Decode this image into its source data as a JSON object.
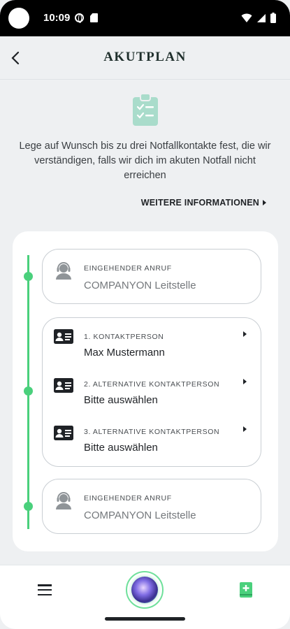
{
  "status_bar": {
    "time": "10:09"
  },
  "header": {
    "title": "AKUTPLAN"
  },
  "intro_text": "Lege auf Wunsch bis zu drei Notfallkontakte fest, die wir verständigen, falls wir dich im akuten Notfall nicht erreichen",
  "more_info_label": "WEITERE INFORMATIONEN",
  "incoming_call_top": {
    "label": "EINGEHENDER ANRUF",
    "value": "COMPANYON Leitstelle"
  },
  "contacts": [
    {
      "label": "1. KONTAKTPERSON",
      "value": "Max Mustermann"
    },
    {
      "label": "2. ALTERNATIVE KONTAKTPERSON",
      "value": "Bitte auswählen"
    },
    {
      "label": "3. ALTERNATIVE KONTAKTPERSON",
      "value": "Bitte auswählen"
    }
  ],
  "incoming_call_bottom": {
    "label": "EINGEHENDER ANRUF",
    "value": "COMPANYON Leitstelle"
  },
  "colors": {
    "accent_green": "#4ad07c",
    "clipboard_mint": "#a9dccb",
    "background": "#eef0f2"
  },
  "icons": {
    "back": "chevron-left-icon",
    "clipboard": "clipboard-checklist-icon",
    "headset": "headset-person-icon",
    "contact": "id-card-icon",
    "menu": "hamburger-menu-icon",
    "center": "assistant-orb-icon",
    "book": "contact-book-plus-icon"
  }
}
